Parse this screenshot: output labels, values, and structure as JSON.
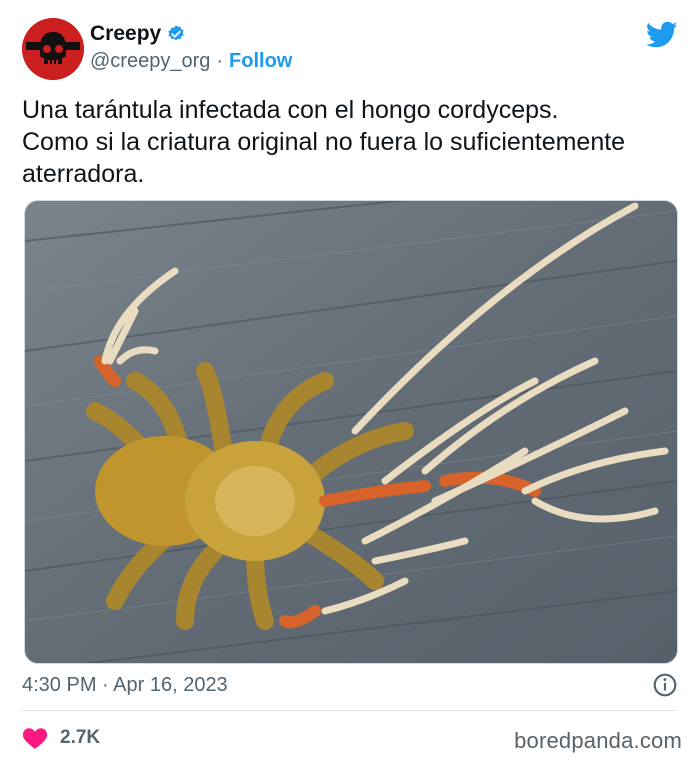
{
  "account": {
    "display_name": "Creepy",
    "handle": "@creepy_org",
    "separator": "·",
    "follow_label": "Follow",
    "verified": true
  },
  "tweet": {
    "text": "Una tarántula infectada con el hongo cordyceps.\nComo si la criatura original no fuera lo suficientemente aterradora.",
    "timestamp": "4:30 PM · Apr 16, 2023",
    "likes": "2.7K"
  },
  "icons": {
    "avatar": "skull-avatar",
    "verified": "verified-badge-icon",
    "platform": "twitter-bird-icon",
    "info": "info-icon",
    "like": "heart-icon"
  },
  "colors": {
    "accent": "#1d9bf0",
    "avatar_bg": "#cc1f1f",
    "like": "#f91880",
    "muted_text": "#536471"
  },
  "watermark": "boredpanda.com"
}
